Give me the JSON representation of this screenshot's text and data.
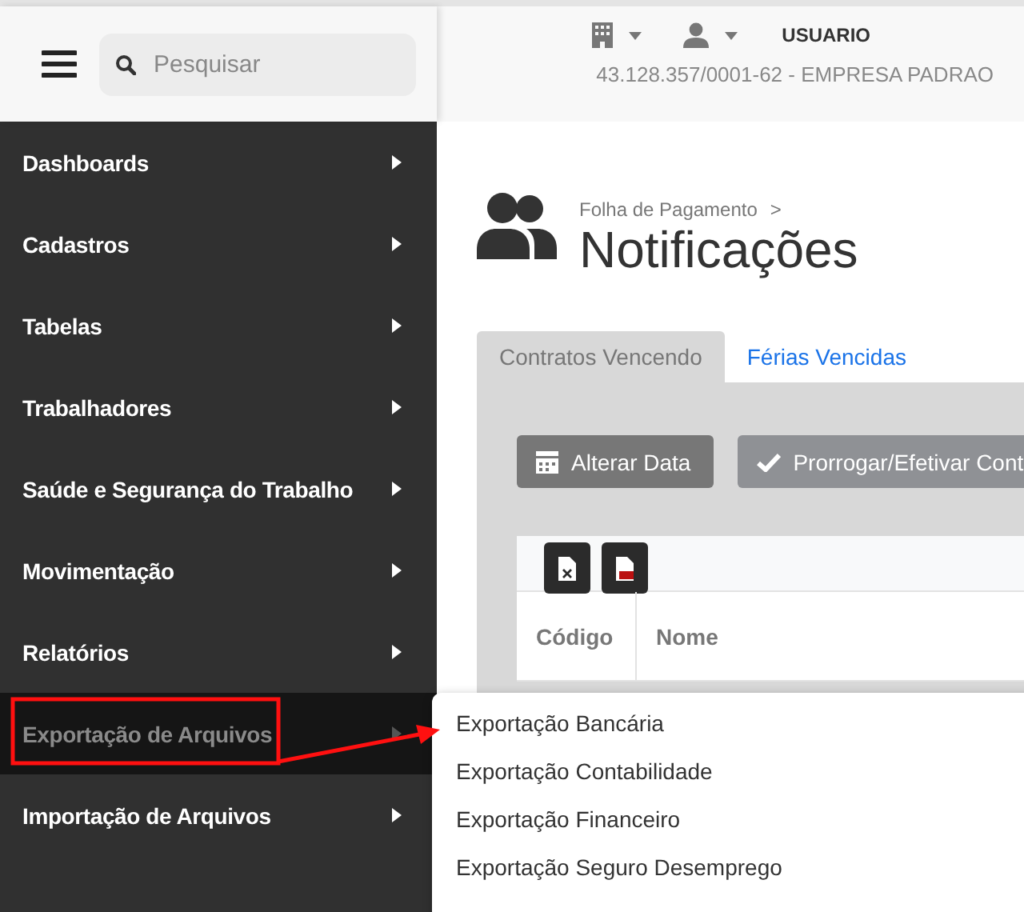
{
  "top_bar": {
    "search": {
      "placeholder": "Pesquisar"
    },
    "user": "USUARIO",
    "company": "43.128.357/0001-62 - EMPRESA PADRAO"
  },
  "sidebar": {
    "items": [
      {
        "label": "Dashboards",
        "selected": false
      },
      {
        "label": "Cadastros",
        "selected": false
      },
      {
        "label": "Tabelas",
        "selected": false
      },
      {
        "label": "Trabalhadores",
        "selected": false
      },
      {
        "label": "Saúde e Segurança do Trabalho",
        "selected": false
      },
      {
        "label": "Movimentação",
        "selected": false
      },
      {
        "label": "Relatórios",
        "selected": false
      },
      {
        "label": "Exportação de Arquivos",
        "selected": true
      },
      {
        "label": "Importação de Arquivos",
        "selected": false
      }
    ]
  },
  "page": {
    "breadcrumb": "Folha de Pagamento",
    "breadcrumb_separator": ">",
    "title": "Notificações"
  },
  "tabs": [
    {
      "label": "Contratos Vencendo",
      "selected": true
    },
    {
      "label": "Férias Vencidas",
      "selected": false
    }
  ],
  "buttons": [
    {
      "label": "Alterar Data",
      "kind": "calendar"
    },
    {
      "label": "Prorrogar/Efetivar Cont",
      "kind": "check"
    }
  ],
  "export_buttons": [
    {
      "kind": "excel"
    },
    {
      "kind": "csv"
    }
  ],
  "table": {
    "columns": [
      "Código",
      "Nome"
    ]
  },
  "submenu": {
    "items": [
      {
        "label": "Exportação Bancária"
      },
      {
        "label": "Exportação Contabilidade"
      },
      {
        "label": "Exportação Financeiro"
      },
      {
        "label": "Exportação Seguro Desemprego"
      }
    ]
  }
}
